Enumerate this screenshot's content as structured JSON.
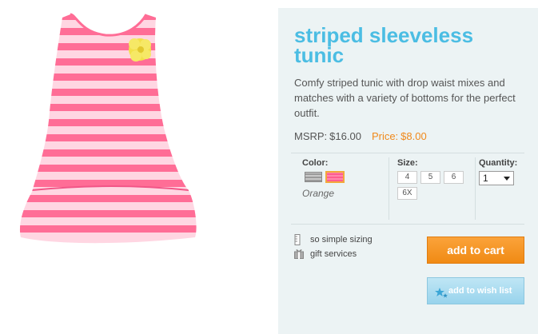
{
  "product": {
    "title": "striped sleeveless tunic",
    "description": "Comfy striped tunic with drop waist mixes and matches with a variety of bottoms for the perfect outfit.",
    "msrp_label": "MSRP:",
    "msrp_value": "$16.00",
    "price_label": "Price:",
    "price_value": "$8.00"
  },
  "options": {
    "color_label": "Color:",
    "color_selected": "Orange",
    "size_label": "Size:",
    "sizes": [
      "4",
      "5",
      "6",
      "6X"
    ],
    "quantity_label": "Quantity:",
    "quantity_value": "1"
  },
  "links": {
    "sizing": "so simple sizing",
    "gift": "gift services"
  },
  "buttons": {
    "add_to_cart": "add to cart",
    "add_to_wish_list": "add to wish list"
  },
  "colors": {
    "accent_blue": "#4bbde3",
    "price_orange": "#f0891b",
    "panel_bg": "#ecf3f4"
  }
}
